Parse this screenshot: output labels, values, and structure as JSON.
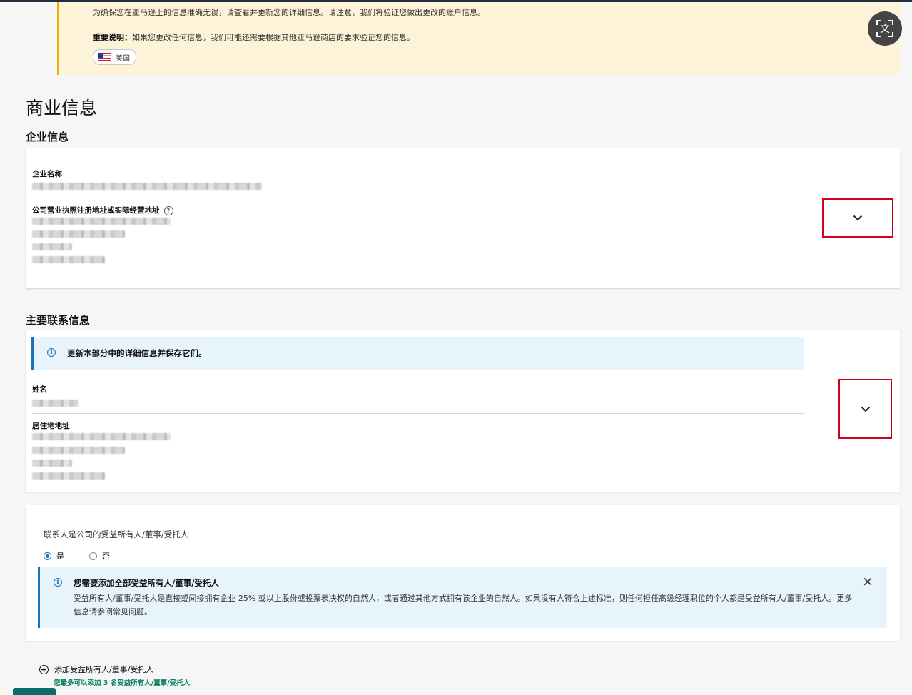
{
  "notice": {
    "line1": "为确保您在亚马逊上的信息准确无误，请查看并更新您的详细信息。请注意，我们将验证您做出更改的账户信息。",
    "important_label": "重要说明：",
    "important_text": "如果您更改任何信息，我们可能还需要根据其他亚马逊商店的要求验证您的信息。",
    "country": "美国"
  },
  "translate": {
    "glyph": "文"
  },
  "page": {
    "title": "商业信息"
  },
  "business": {
    "heading": "企业信息",
    "name_label": "企业名称",
    "address_label": "公司营业执照注册地址或实际经营地址",
    "help_glyph": "?"
  },
  "contact": {
    "heading": "主要联系信息",
    "alert_text": "更新本部分中的详细信息并保存它们。",
    "info_glyph": "i",
    "name_label": "姓名",
    "address_label": "居住地地址"
  },
  "beneficial": {
    "question": "联系人是公司的受益所有人/董事/受托人",
    "yes": "是",
    "no": "否",
    "selected": "是",
    "alert_title": "您需要添加全部受益所有人/董事/受托人",
    "alert_body": "受益所有人/董事/受托人是直接或间接拥有企业 25% 或以上股份或投票表决权的自然人，或者通过其他方式拥有该企业的自然人。如果没有人符合上述标准，则任何担任高级经理职位的个人都是受益所有人/董事/受托人。更多信息请参阅常见问题。",
    "close_glyph": "×"
  },
  "add": {
    "label": "添加受益所有人/董事/受托人",
    "note": "您最多可以添加 3 名受益所有人/董事/受托人",
    "plus_glyph": "+"
  }
}
